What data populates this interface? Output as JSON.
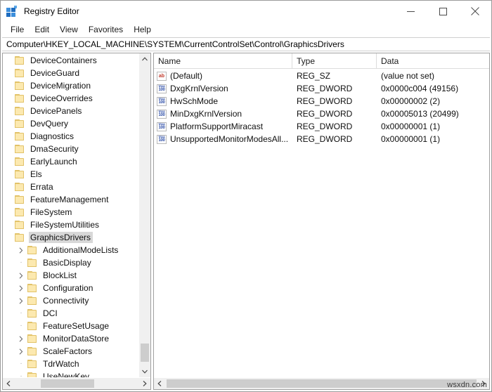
{
  "window": {
    "title": "Registry Editor",
    "icon": "registry-editor-icon",
    "controls": {
      "minimize": "minimize-icon",
      "maximize": "maximize-icon",
      "close": "close-icon"
    }
  },
  "menu": {
    "items": [
      {
        "label": "File"
      },
      {
        "label": "Edit"
      },
      {
        "label": "View"
      },
      {
        "label": "Favorites"
      },
      {
        "label": "Help"
      }
    ]
  },
  "address": {
    "path": "Computer\\HKEY_LOCAL_MACHINE\\SYSTEM\\CurrentControlSet\\Control\\GraphicsDrivers"
  },
  "tree": {
    "items": [
      {
        "label": "DeviceContainers",
        "expandable": false,
        "indent": 0,
        "selected": false
      },
      {
        "label": "DeviceGuard",
        "expandable": false,
        "indent": 0,
        "selected": false
      },
      {
        "label": "DeviceMigration",
        "expandable": false,
        "indent": 0,
        "selected": false
      },
      {
        "label": "DeviceOverrides",
        "expandable": false,
        "indent": 0,
        "selected": false
      },
      {
        "label": "DevicePanels",
        "expandable": false,
        "indent": 0,
        "selected": false
      },
      {
        "label": "DevQuery",
        "expandable": false,
        "indent": 0,
        "selected": false
      },
      {
        "label": "Diagnostics",
        "expandable": false,
        "indent": 0,
        "selected": false
      },
      {
        "label": "DmaSecurity",
        "expandable": false,
        "indent": 0,
        "selected": false
      },
      {
        "label": "EarlyLaunch",
        "expandable": false,
        "indent": 0,
        "selected": false
      },
      {
        "label": "Els",
        "expandable": false,
        "indent": 0,
        "selected": false
      },
      {
        "label": "Errata",
        "expandable": false,
        "indent": 0,
        "selected": false
      },
      {
        "label": "FeatureManagement",
        "expandable": false,
        "indent": 0,
        "selected": false
      },
      {
        "label": "FileSystem",
        "expandable": false,
        "indent": 0,
        "selected": false
      },
      {
        "label": "FileSystemUtilities",
        "expandable": false,
        "indent": 0,
        "selected": false
      },
      {
        "label": "GraphicsDrivers",
        "expandable": false,
        "indent": 0,
        "selected": true
      },
      {
        "label": "AdditionalModeLists",
        "expandable": true,
        "indent": 1,
        "selected": false
      },
      {
        "label": "BasicDisplay",
        "expandable": false,
        "indent": 1,
        "selected": false
      },
      {
        "label": "BlockList",
        "expandable": true,
        "indent": 1,
        "selected": false
      },
      {
        "label": "Configuration",
        "expandable": true,
        "indent": 1,
        "selected": false
      },
      {
        "label": "Connectivity",
        "expandable": true,
        "indent": 1,
        "selected": false
      },
      {
        "label": "DCI",
        "expandable": false,
        "indent": 1,
        "selected": false
      },
      {
        "label": "FeatureSetUsage",
        "expandable": false,
        "indent": 1,
        "selected": false
      },
      {
        "label": "MonitorDataStore",
        "expandable": true,
        "indent": 1,
        "selected": false
      },
      {
        "label": "ScaleFactors",
        "expandable": true,
        "indent": 1,
        "selected": false
      },
      {
        "label": "TdrWatch",
        "expandable": false,
        "indent": 1,
        "selected": false
      },
      {
        "label": "UseNewKey",
        "expandable": false,
        "indent": 1,
        "selected": false
      }
    ]
  },
  "list": {
    "columns": [
      {
        "label": "Name"
      },
      {
        "label": "Type"
      },
      {
        "label": "Data"
      }
    ],
    "rows": [
      {
        "icon": "string-value-icon",
        "icon_kind": "sz",
        "name": "(Default)",
        "type": "REG_SZ",
        "data": "(value not set)"
      },
      {
        "icon": "dword-value-icon",
        "icon_kind": "dword",
        "name": "DxgKrnlVersion",
        "type": "REG_DWORD",
        "data": "0x0000c004 (49156)"
      },
      {
        "icon": "dword-value-icon",
        "icon_kind": "dword",
        "name": "HwSchMode",
        "type": "REG_DWORD",
        "data": "0x00000002 (2)"
      },
      {
        "icon": "dword-value-icon",
        "icon_kind": "dword",
        "name": "MinDxgKrnlVersion",
        "type": "REG_DWORD",
        "data": "0x00005013 (20499)"
      },
      {
        "icon": "dword-value-icon",
        "icon_kind": "dword",
        "name": "PlatformSupportMiracast",
        "type": "REG_DWORD",
        "data": "0x00000001 (1)"
      },
      {
        "icon": "dword-value-icon",
        "icon_kind": "dword",
        "name": "UnsupportedMonitorModesAll...",
        "type": "REG_DWORD",
        "data": "0x00000001 (1)"
      }
    ]
  },
  "watermark": {
    "text": "wsxdn.com"
  },
  "colors": {
    "folder": "#fce9b0",
    "selection": "#d8d8d8",
    "string_icon": "#c0392b",
    "dword_icon": "#2f4fa8"
  }
}
